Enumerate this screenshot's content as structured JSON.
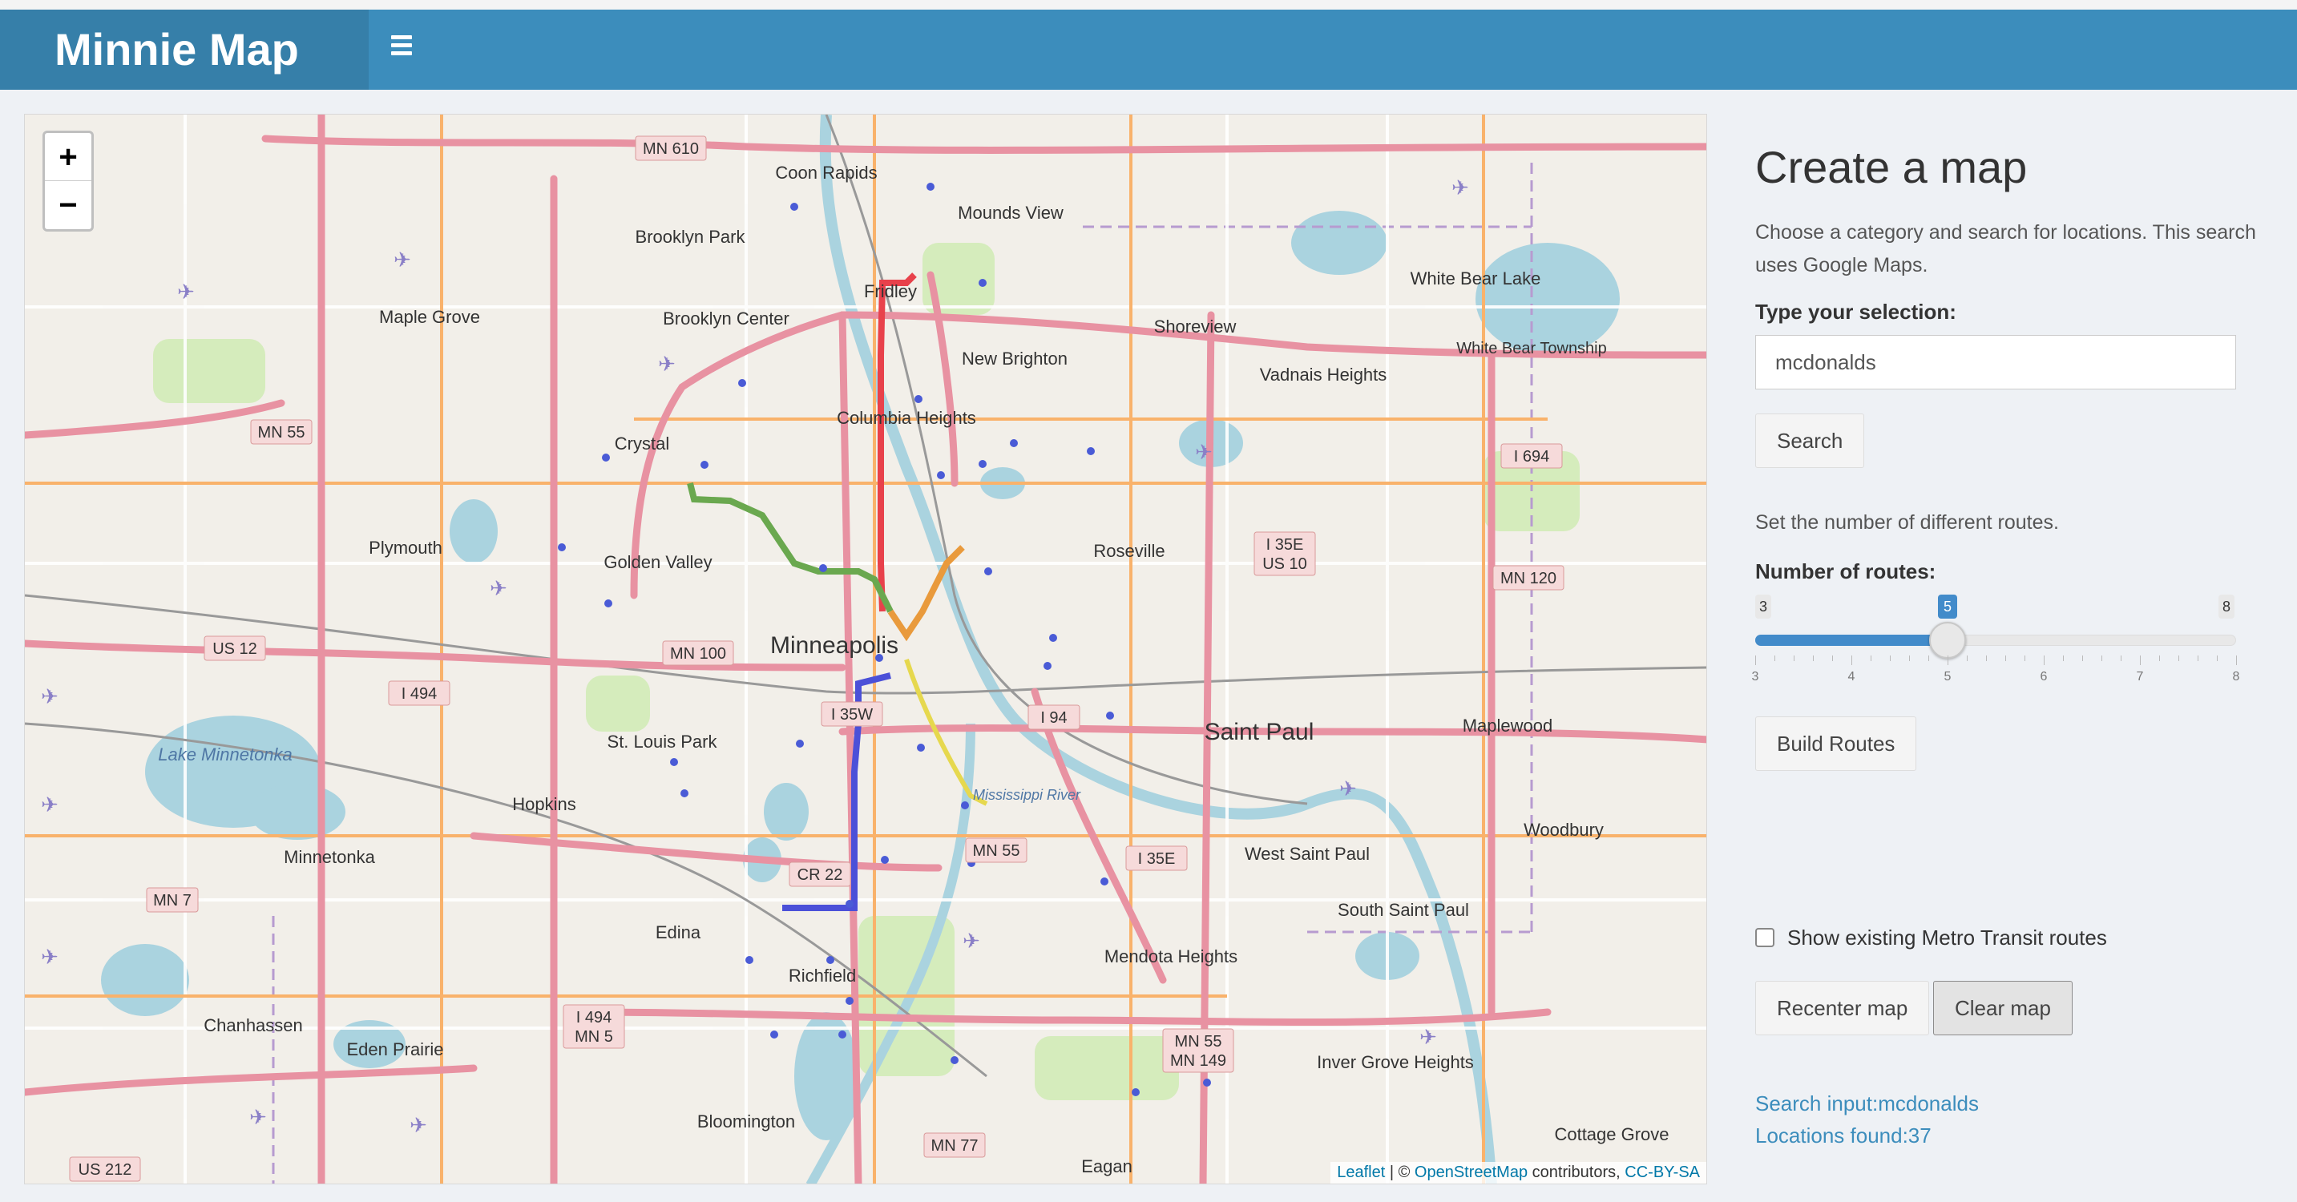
{
  "header": {
    "brand": "Minnie Map"
  },
  "map": {
    "zoom_in": "+",
    "zoom_out": "−",
    "attribution": {
      "leaflet": "Leaflet",
      "separator": " | © ",
      "osm": "OpenStreetMap",
      "contributors": " contributors, ",
      "license": "CC-BY-SA"
    },
    "labels": {
      "minneapolis": "Minneapolis",
      "saint_paul": "Saint Paul",
      "coon_rapids": "Coon Rapids",
      "brooklyn_park": "Brooklyn Park",
      "brooklyn_center": "Brooklyn Center",
      "maple_grove": "Maple Grove",
      "fridley": "Fridley",
      "mounds_view": "Mounds View",
      "new_brighton": "New Brighton",
      "shoreview": "Shoreview",
      "white_bear_lake": "White Bear Lake",
      "vadnais_heights": "Vadnais Heights",
      "columbia_heights": "Columbia Heights",
      "crystal": "Crystal",
      "plymouth": "Plymouth",
      "golden_valley": "Golden Valley",
      "roseville": "Roseville",
      "st_louis_park": "St. Louis Park",
      "hopkins": "Hopkins",
      "minnetonka": "Minnetonka",
      "lake_minnetonka": "Lake Minnetonka",
      "edina": "Edina",
      "richfield": "Richfield",
      "bloomington": "Bloomington",
      "eden_prairie": "Eden Prairie",
      "chanhassen": "Chanhassen",
      "mendota_heights": "Mendota Heights",
      "west_saint_paul": "West Saint Paul",
      "south_saint_paul": "South Saint Paul",
      "inver_grove_heights": "Inver Grove Heights",
      "maplewood": "Maplewood",
      "woodbury": "Woodbury",
      "cottage_grove": "Cottage Grove",
      "eagan": "Eagan",
      "mississippi_river": "Mississippi River",
      "white_bear_township": "White Bear Township"
    },
    "shields": {
      "mn610": "MN 610",
      "mn55_w": "MN 55",
      "us12": "US 12",
      "i494_w": "I 494",
      "mn100": "MN 100",
      "i35w": "I 35W",
      "i94": "I 94",
      "cr22": "CR 22",
      "mn55_s": "MN 55",
      "i35e": "I 35E",
      "i35e_us10": "I 35E US 10",
      "i694": "I 694",
      "mn120": "MN 120",
      "mn7": "MN 7",
      "i494_mn5": "I 494 MN 5",
      "mn55_mn149": "MN 55 MN 149",
      "mn77": "MN 77",
      "us212": "US 212"
    },
    "colors": {
      "route_red": "#e8414b",
      "route_green": "#6aa84f",
      "route_blue": "#4b50d8",
      "route_orange": "#e99a3c",
      "route_yellow": "#e6d84e",
      "marker": "#4a5bd6"
    }
  },
  "panel": {
    "title": "Create a map",
    "description": "Choose a category and search for locations. This search uses Google Maps.",
    "selection_label": "Type your selection:",
    "selection_value": "mcdonalds",
    "search_button": "Search",
    "routes_hint": "Set the number of different routes.",
    "routes_label": "Number of routes:",
    "slider": {
      "min": 3,
      "max": 8,
      "value": 5,
      "min_label": "3",
      "max_label": "8",
      "value_label": "5",
      "ticks": [
        "3",
        "4",
        "5",
        "6",
        "7",
        "8"
      ]
    },
    "build_button": "Build Routes",
    "metro_checkbox_label": "Show existing Metro Transit routes",
    "metro_checked": false,
    "recenter_button": "Recenter map",
    "clear_button": "Clear map",
    "search_input_text": "Search input:mcdonalds",
    "locations_found_text": "Locations found:37"
  }
}
